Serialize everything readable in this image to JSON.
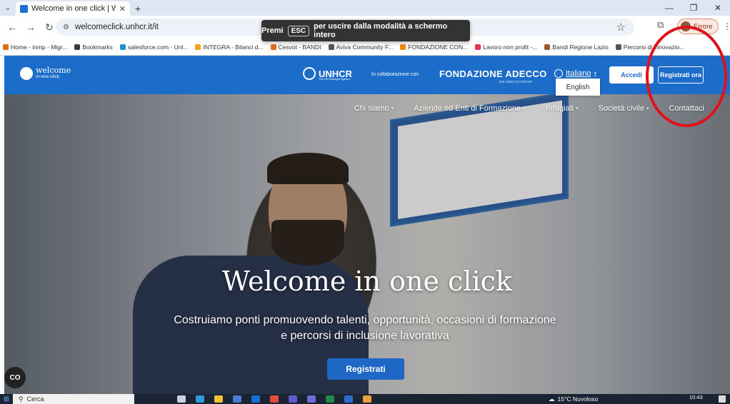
{
  "browser": {
    "tab_title": "Welcome in one click | Welcom",
    "url": "welcomeclick.unhcr.it/it",
    "profile_label": "Errore",
    "fullscreen_toast": {
      "prefix": "Premi",
      "key": "ESC",
      "suffix": "per uscire dalla modalità a schermo intero"
    }
  },
  "bookmarks": [
    {
      "label": "Home - inmp - Migr...",
      "color": "#d9711c"
    },
    {
      "label": "Bookmarks",
      "color": "#3a3a3a"
    },
    {
      "label": "salesforce.com - Unl...",
      "color": "#1a8ed8"
    },
    {
      "label": "INTEGRA - Bilanci d...",
      "color": "#f0a41e"
    },
    {
      "label": "Cesvot - BANDI",
      "color": "#e46a1a"
    },
    {
      "label": "Aviva Community F...",
      "color": "#555555"
    },
    {
      "label": "FONDAZIONE CON...",
      "color": "#f08a00"
    },
    {
      "label": "Lavoro non profit -...",
      "color": "#e6335a"
    },
    {
      "label": "Bandi Regione Lazio",
      "color": "#a0562a"
    },
    {
      "label": "Percorsi di innovazio...",
      "color": "#555555"
    }
  ],
  "site": {
    "logo": {
      "main": "welcome",
      "sub": "in-one-click"
    },
    "partner_unhcr": "UNHCR",
    "partner_unhcr_tag": "The UN Refugee Agency",
    "collab_label": "In collaborazione con",
    "partner_adecco": "FONDAZIONE ADECCO",
    "partner_adecco_tag": "THE ADECCO GROUP",
    "language": "Italiano",
    "language_option": "English",
    "login_label": "Accedi",
    "register_label": "Registrati ora",
    "nav": [
      "Chi siamo",
      "Aziende ed Enti di Formazione",
      "Rifugiati",
      "Società civile",
      "Contattaci"
    ],
    "hero": {
      "title": "Welcome in one click",
      "subtitle": "Costruiamo ponti promuovendo talenti, opportunità, occasioni di formazione e percorsi di inclusione lavorativa",
      "cta": "Registrati"
    },
    "co_badge": "CO"
  },
  "taskbar": {
    "search_placeholder": "Cerca",
    "weather": "15°C  Nuvoloso",
    "time": "10:43"
  },
  "colors": {
    "brand": "#1c6cc9",
    "annotation": "#e0111a"
  }
}
